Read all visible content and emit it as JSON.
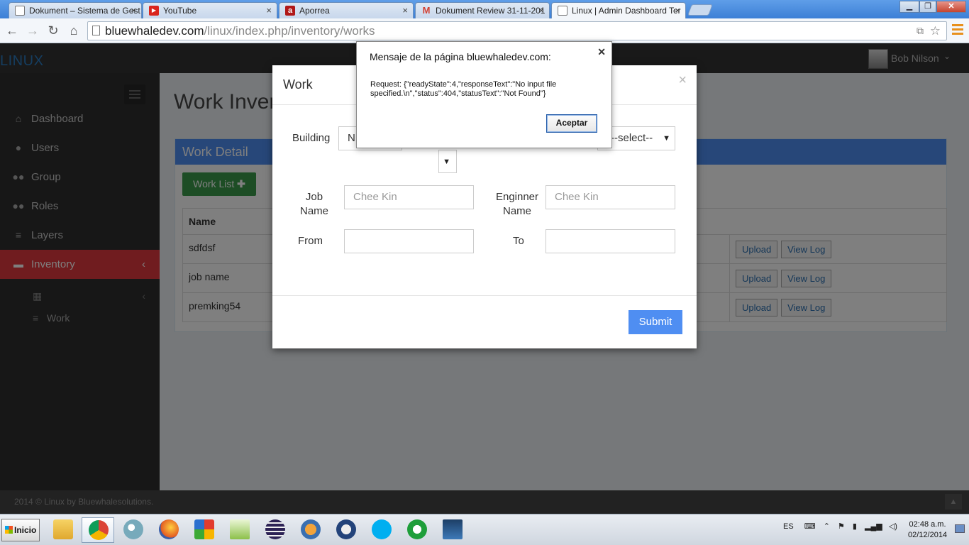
{
  "browser": {
    "tabs": [
      {
        "title": "Dokument – Sistema de Gest",
        "icon": "document-icon"
      },
      {
        "title": "YouTube",
        "icon": "youtube-icon"
      },
      {
        "title": "Aporrea",
        "icon": "aporrea-icon"
      },
      {
        "title": "Dokument Review 31-11-201",
        "icon": "gmail-icon"
      },
      {
        "title": "Linux | Admin Dashboard Ter",
        "icon": "document-icon"
      }
    ],
    "url_host": "bluewhaledev.com",
    "url_path": "/linux/index.php/inventory/works"
  },
  "app": {
    "logo": "LINUX",
    "user_name": "Bob Nilson",
    "sidebar": {
      "items": [
        {
          "label": "Dashboard",
          "icon": "home-icon"
        },
        {
          "label": "Users",
          "icon": "user-icon"
        },
        {
          "label": "Group",
          "icon": "group-icon"
        },
        {
          "label": "Roles",
          "icon": "group-icon"
        },
        {
          "label": "Layers",
          "icon": "list-icon"
        },
        {
          "label": "Inventory",
          "icon": "inventory-icon"
        }
      ],
      "subitems": [
        {
          "label": "",
          "icon": "building-icon"
        },
        {
          "label": "Work",
          "icon": "list-icon"
        }
      ]
    },
    "page_title": "Work Inventory",
    "box_title": "Work Detail",
    "work_list_button": "Work List",
    "table": {
      "header": "Name",
      "rows": [
        "sdfdsf",
        "job name",
        "premking54"
      ],
      "upload_label": "Upload",
      "view_log_label": "View Log"
    },
    "footer": "2014 © Linux by Bluewhalesolutions."
  },
  "modal": {
    "title": "Work",
    "close": "×",
    "building_label": "Building",
    "building_value": "N",
    "select_placeholder": "--select--",
    "job_name_label": "Job Name",
    "job_name_placeholder": "Chee Kin",
    "engineer_name_label": "Enginner Name",
    "engineer_name_placeholder": "Chee Kin",
    "from_label": "From",
    "to_label": "To",
    "submit": "Submit"
  },
  "alert": {
    "title": "Mensaje de la página bluewhaledev.com:",
    "message": "Request: {\"readyState\":4,\"responseText\":\"No input file specified.\\n\",\"status\":404,\"statusText\":\"Not Found\"}",
    "ok": "Aceptar"
  },
  "taskbar": {
    "start": "Inicio",
    "lang": "ES",
    "time": "02:48 a.m.",
    "date": "02/12/2014"
  },
  "colors": {
    "accent_blue": "#4f8ef2",
    "active_red": "#e0383e",
    "green": "#3a9b4a"
  }
}
